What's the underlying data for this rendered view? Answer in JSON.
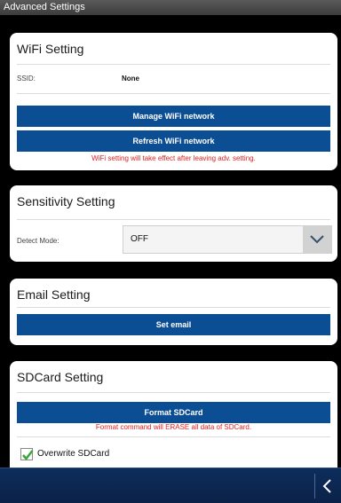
{
  "window": {
    "title": "Advanced Settings"
  },
  "wifi": {
    "title": "WiFi Setting",
    "ssid_label": "SSID:",
    "ssid_value": "None",
    "manage_button": "Manage WiFi network",
    "refresh_button": "Refresh WiFi network",
    "warning": "WiFi setting will take effect after leaving adv. setting."
  },
  "sensitivity": {
    "title": "Sensitivity Setting",
    "detect_label": "Detect Mode:",
    "detect_value": "OFF",
    "dropdown_icon": "chevron-down-icon"
  },
  "email": {
    "title": "Email Setting",
    "set_button": "Set email"
  },
  "sdcard": {
    "title": "SDCard Setting",
    "format_button": "Format SDCard",
    "warning": "Format command will ERASE all data of SDCard.",
    "overwrite_label": "Overwrite SDCard",
    "overwrite_checked": true
  },
  "navbar": {
    "back_icon": "back-chevron-icon"
  },
  "colors": {
    "button": "#0c4e93",
    "warning": "#e02020",
    "navbar": "#0e2d5c",
    "check": "#3aa63a"
  }
}
